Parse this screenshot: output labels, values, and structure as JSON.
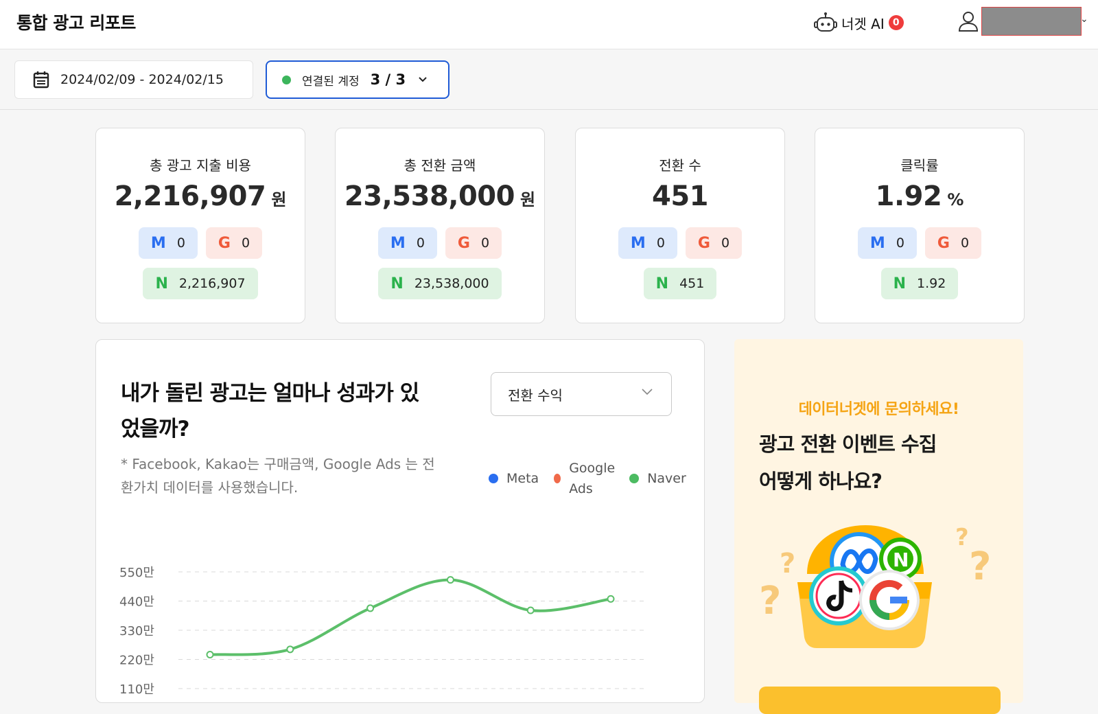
{
  "header": {
    "title": "통합 광고 리포트",
    "ai_label": "너겟 AI",
    "ai_badge": "0",
    "user_caret": "⌄"
  },
  "filters": {
    "date_range": "2024/02/09 - 2024/02/15",
    "account_label": "연결된 계정",
    "account_count": "3 / 3"
  },
  "kpis": [
    {
      "title": "총 광고 지출 비용",
      "value": "2,216,907",
      "unit": "원",
      "meta": "0",
      "google": "0",
      "naver": "2,216,907"
    },
    {
      "title": "총 전환 금액",
      "value": "23,538,000",
      "unit": "원",
      "meta": "0",
      "google": "0",
      "naver": "23,538,000"
    },
    {
      "title": "전환 수",
      "value": "451",
      "unit": "",
      "meta": "0",
      "google": "0",
      "naver": "451"
    },
    {
      "title": "클릭률",
      "value": "1.92",
      "unit": "%",
      "meta": "0",
      "google": "0",
      "naver": "1.92"
    }
  ],
  "platform_letters": {
    "meta": "M",
    "google": "G",
    "naver": "N"
  },
  "chart_section": {
    "heading": "내가 돌린 광고는 얼마나 성과가 있었을까?",
    "note": "* Facebook, Kakao는 구매금액, Google Ads 는 전환가치 데이터를 사용했습니다.",
    "metric_select": "전환 수익",
    "legend": [
      "Meta",
      "Google Ads",
      "Naver"
    ]
  },
  "chart_data": {
    "type": "line",
    "y_tick_labels": [
      "550만",
      "440만",
      "330만",
      "220만",
      "110만"
    ],
    "y_ticks": [
      5500000,
      4400000,
      3300000,
      2200000,
      1100000
    ],
    "ylim": [
      1100000,
      5500000
    ],
    "grid": true,
    "series": [
      {
        "name": "Naver",
        "color": "#5cbf6a",
        "values": [
          2380000,
          2580000,
          4130000,
          5200000,
          4050000,
          4480000
        ]
      }
    ]
  },
  "promo": {
    "kicker": "데이터너겟에 문의하세요!",
    "title_line1": "광고 전환 이벤트 수집",
    "title_line2": "어떻게 하나요?"
  },
  "colors": {
    "accent_blue": "#1f5bd6",
    "meta_blue": "#2a6ef0",
    "google_red": "#ef5a3a",
    "naver_green": "#2bb24c",
    "promo_yellow": "#f5a414"
  }
}
